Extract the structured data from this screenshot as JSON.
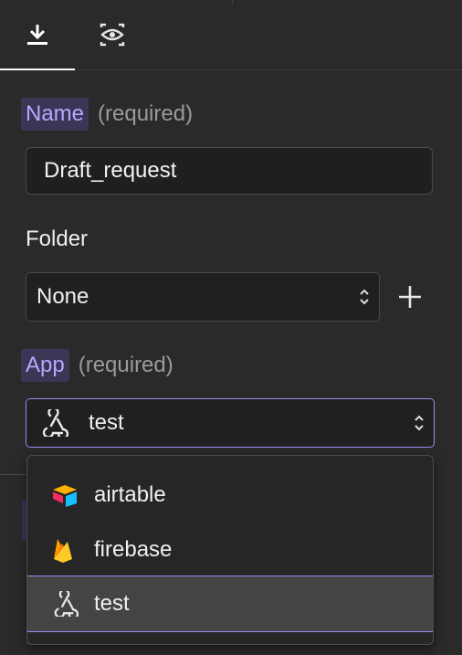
{
  "tabs": [
    {
      "icon": "download-icon",
      "active": true
    },
    {
      "icon": "eye-preview-icon",
      "active": false
    }
  ],
  "form": {
    "name": {
      "label": "Name",
      "required_text": "(required)",
      "value": "Draft_request"
    },
    "folder": {
      "label": "Folder",
      "selected": "None"
    },
    "app": {
      "label": "App",
      "required_text": "(required)",
      "selected": "test",
      "selected_icon": "webhook-icon"
    }
  },
  "app_options": [
    {
      "label": "airtable",
      "icon": "airtable-icon",
      "selected": false
    },
    {
      "label": "firebase",
      "icon": "firebase-icon",
      "selected": false
    },
    {
      "label": "test",
      "icon": "webhook-icon",
      "selected": true
    }
  ],
  "colors": {
    "accent": "#9d8cf4",
    "label_chip_bg": "#3d3556",
    "label_chip_text": "#b6a9ff",
    "background": "#2a2a2a"
  }
}
